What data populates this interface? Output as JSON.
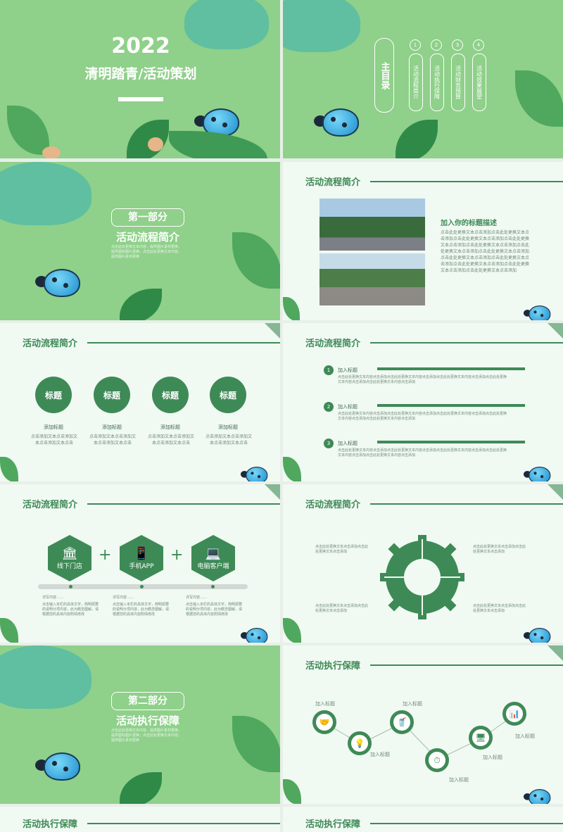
{
  "cover": {
    "year": "2022",
    "title": "清明踏青/活动策划"
  },
  "toc": {
    "heading": "主目录",
    "items": [
      {
        "num": "1",
        "label": "活动流程简介"
      },
      {
        "num": "2",
        "label": "活动执行保障"
      },
      {
        "num": "3",
        "label": "活动财务预算"
      },
      {
        "num": "4",
        "label": "活动效果展望"
      }
    ]
  },
  "section1": {
    "part": "第一部分",
    "title": "活动流程简介",
    "desc": "点击此处更换文本内容，提供图片素材更换，提供图标图片更换；点击此处更换文本内容，提供图片素材更换"
  },
  "section2": {
    "part": "第二部分",
    "title": "活动执行保障",
    "desc": "点击此处更换文本内容，提供图片素材更换，提供图标图片更换；点击此处更换文本内容，提供图片素材更换"
  },
  "headers": {
    "flow": "活动流程简介",
    "exec": "活动执行保障"
  },
  "slide_photo": {
    "subtitle": "加入你的标题描述",
    "body": "点击此处更换文本点击添加点击此处更换文本点击添加点击此处更换文本点击添加点击此处更换文本点击添加点击此处更换文本点击添加点击此处更换文本点击添加点击此处更换文本点击添加点击此处更换文本点击添加点击此处更换文本点击添加点击此处更换文本点击添加点击此处更换文本点击添加点击此处更换文本点击添加"
  },
  "slide_circles": {
    "items": [
      {
        "label": "标题",
        "sub": "添加标题",
        "desc": "点击添加文本点击添加文本点击添加文本点击"
      },
      {
        "label": "标题",
        "sub": "添加标题",
        "desc": "点击添加文本点击添加文本点击添加文本点击"
      },
      {
        "label": "标题",
        "sub": "添加标题",
        "desc": "点击添加文本点击添加文本点击添加文本点击"
      },
      {
        "label": "标题",
        "sub": "添加标题",
        "desc": "点击添加文本点击添加文本点击添加文本点击"
      }
    ]
  },
  "slide_list": {
    "items": [
      {
        "num": "1",
        "title": "加入标题",
        "text": "点击此处更换文本内容点击添加点击此处更换文本内容点击添加点击此处更换文本内容点击添加点击此处更换文本内容点击添加点击此处更换文本内容点击添加"
      },
      {
        "num": "2",
        "title": "加入标题",
        "text": "点击此处更换文本内容点击添加点击此处更换文本内容点击添加点击此处更换文本内容点击添加点击此处更换文本内容点击添加点击此处更换文本内容点击添加"
      },
      {
        "num": "3",
        "title": "加入标题",
        "text": "点击此处更换文本内容点击添加点击此处更换文本内容点击添加点击此处更换文本内容点击添加点击此处更换文本内容点击添加点击此处更换文本内容点击添加"
      }
    ]
  },
  "slide_hex": {
    "items": [
      {
        "icon": "bank-icon",
        "label": "线下门店",
        "glyph": "🏛"
      },
      {
        "icon": "phone-icon",
        "label": "手机APP",
        "glyph": "📱"
      },
      {
        "icon": "computer-icon",
        "label": "电脑客户端",
        "glyph": "💻"
      }
    ],
    "plus": "+",
    "notes": [
      {
        "title": "详写内容……",
        "text": "点击输入本栏的具体文字，简明扼要的说明分项内容，此为概念图解，请根据您的具体内容酌情修改"
      },
      {
        "title": "详写内容……",
        "text": "点击输入本栏的具体文字，简明扼要的说明分项内容，此为概念图解，请根据您的具体内容酌情修改"
      },
      {
        "title": "详写内容……",
        "text": "点击输入本栏的具体文字，简明扼要的说明分项内容，此为概念图解，请根据您的具体内容酌情修改"
      }
    ]
  },
  "slide_gear": {
    "texts": [
      "点击此处更换文本点击添加点击此处更换文本点击添加",
      "点击此处更换文本点击添加点击此处更换文本点击添加",
      "点击此处更换文本点击添加点击此处更换文本点击添加",
      "点击此处更换文本点击添加点击此处更换文本点击添加"
    ]
  },
  "slide_network": {
    "labels": [
      "加入标题",
      "加入标题",
      "加入标题",
      "加入标题",
      "加入标题",
      "加入标题"
    ]
  }
}
